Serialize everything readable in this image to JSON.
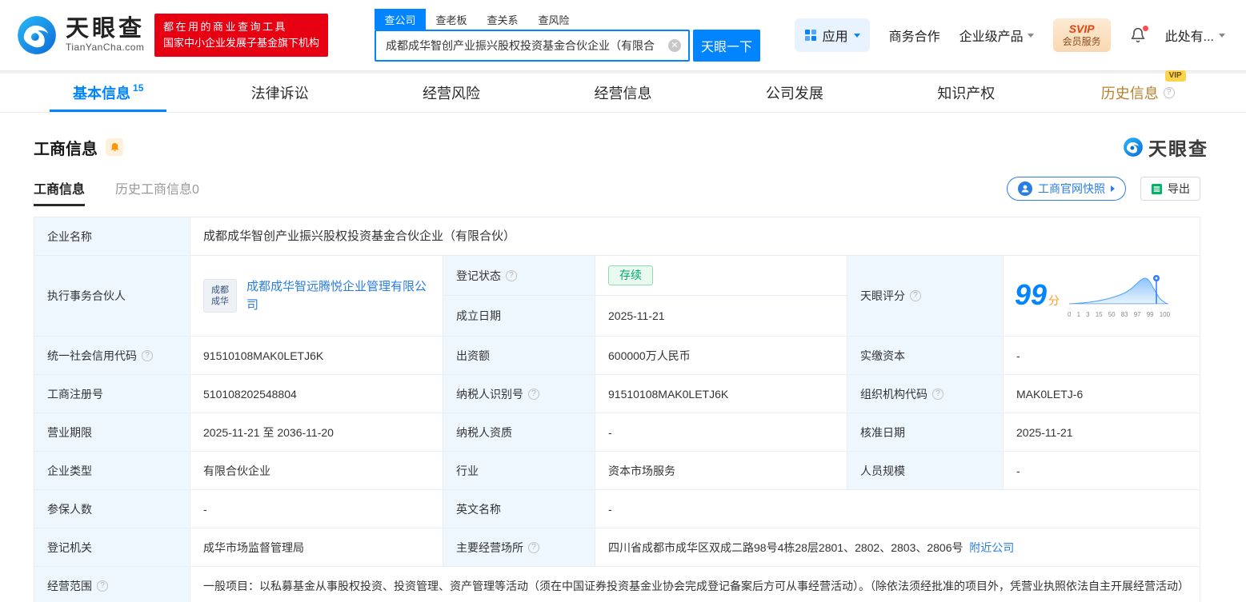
{
  "brand": {
    "name": "天眼查",
    "domain": "TianYanCha.com",
    "slogan_line1": "都在用的商业查询工具",
    "slogan_line2": "国家中小企业发展子基金旗下机构"
  },
  "header": {
    "search": {
      "tabs": [
        {
          "label": "查公司",
          "active": true
        },
        {
          "label": "查老板"
        },
        {
          "label": "查关系"
        },
        {
          "label": "查风险"
        }
      ],
      "value": "成都成华智创产业振兴股权投资基金合伙企业（有限合",
      "button": "天眼一下"
    },
    "apps_label": "应用",
    "coop_link": "商务合作",
    "enterprise_link": "企业级产品",
    "vip_line1": "SVIP",
    "vip_line2": "会员服务",
    "user": "此处有..."
  },
  "nav": {
    "vip_badge": "VIP",
    "tabs": [
      {
        "label": "基本信息",
        "count": "15",
        "active": true
      },
      {
        "label": "法律诉讼"
      },
      {
        "label": "经营风险"
      },
      {
        "label": "经营信息"
      },
      {
        "label": "公司发展"
      },
      {
        "label": "知识产权"
      },
      {
        "label": "历史信息",
        "vip": true,
        "help": true
      }
    ]
  },
  "section": {
    "title": "工商信息",
    "watermark": "天眼查",
    "subtabs": [
      {
        "label": "工商信息",
        "active": true
      },
      {
        "label": "历史工商信息",
        "count": "0"
      }
    ],
    "snapshot_btn": "工商官网快照",
    "export_btn": "导出"
  },
  "table": {
    "company_name": {
      "label": "企业名称",
      "value": "成都成华智创产业振兴股权投资基金合伙企业（有限合伙）"
    },
    "partner": {
      "label": "执行事务合伙人",
      "logo_line1": "成都",
      "logo_line2": "成华",
      "company": "成都成华智远腾悦企业管理有限公司"
    },
    "reg_status": {
      "label": "登记状态",
      "value": "存续"
    },
    "establish_date": {
      "label": "成立日期",
      "value": "2025-11-21"
    },
    "score": {
      "label": "天眼评分",
      "value": "99",
      "unit": "分",
      "ticks": [
        "0",
        "1",
        "3",
        "15",
        "50",
        "83",
        "97",
        "99",
        "100"
      ]
    },
    "credit_code": {
      "label": "统一社会信用代码",
      "value": "91510108MAK0LETJ6K"
    },
    "capital": {
      "label": "出资额",
      "value": "600000万人民币"
    },
    "paid_capital": {
      "label": "实缴资本",
      "value": "-"
    },
    "reg_number": {
      "label": "工商注册号",
      "value": "510108202548804"
    },
    "taxpayer_id": {
      "label": "纳税人识别号",
      "value": "91510108MAK0LETJ6K"
    },
    "org_code": {
      "label": "组织机构代码",
      "value": "MAK0LETJ-6"
    },
    "business_term": {
      "label": "营业期限",
      "value": "2025-11-21 至 2036-11-20"
    },
    "taxpayer_quality": {
      "label": "纳税人资质",
      "value": "-"
    },
    "approval_date": {
      "label": "核准日期",
      "value": "2025-11-21"
    },
    "company_type": {
      "label": "企业类型",
      "value": "有限合伙企业"
    },
    "industry": {
      "label": "行业",
      "value": "资本市场服务"
    },
    "staff_size": {
      "label": "人员规模",
      "value": "-"
    },
    "insured_count": {
      "label": "参保人数",
      "value": "-"
    },
    "english_name": {
      "label": "英文名称",
      "value": "-"
    },
    "reg_authority": {
      "label": "登记机关",
      "value": "成华市场监督管理局"
    },
    "premises": {
      "label": "主要经营场所",
      "value": "四川省成都市成华区双成二路98号4栋28层2801、2802、2803、2806号",
      "link": "附近公司"
    },
    "business_scope": {
      "label": "经营范围",
      "value": "一般项目：以私募基金从事股权投资、投资管理、资产管理等活动（须在中国证券投资基金业协会完成登记备案后方可从事经营活动）。（除依法须经批准的项目外，凭营业执照依法自主开展经营活动）"
    }
  }
}
